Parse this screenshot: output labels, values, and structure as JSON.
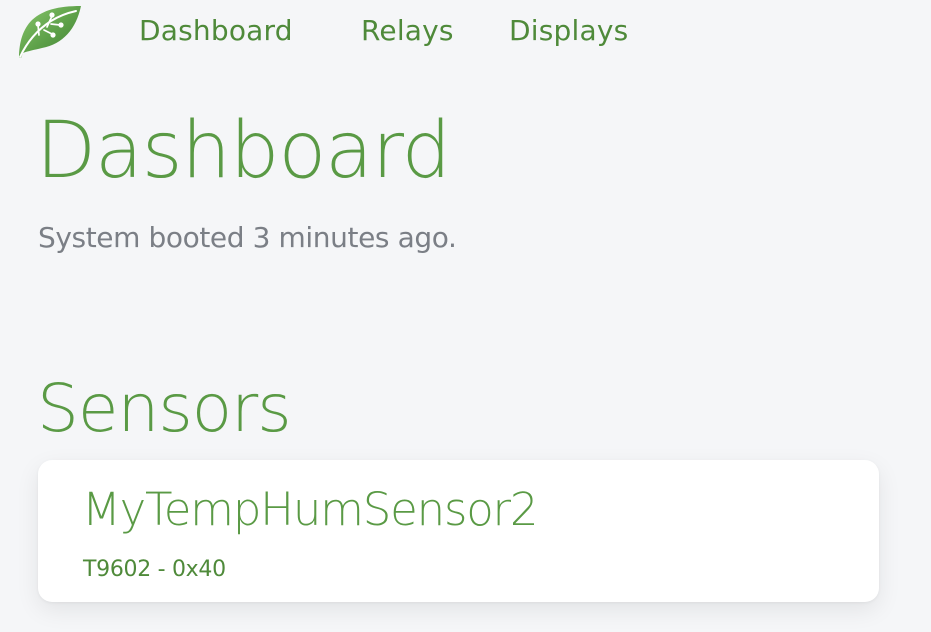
{
  "nav": {
    "logo_icon": "leaf-icon",
    "items": [
      {
        "label": "Dashboard"
      },
      {
        "label": "Relays"
      },
      {
        "label": "Displays"
      }
    ]
  },
  "dashboard": {
    "title": "Dashboard",
    "boot_status": "System booted 3 minutes ago."
  },
  "sensors": {
    "title": "Sensors",
    "items": [
      {
        "name": "MyTempHumSensor2",
        "meta": "T9602 - 0x40"
      }
    ]
  },
  "colors": {
    "accent": "#5a9a45",
    "nav_link": "#4f8a3a",
    "muted_text": "#7b7f86",
    "background": "#f5f6f8",
    "card": "#ffffff"
  }
}
